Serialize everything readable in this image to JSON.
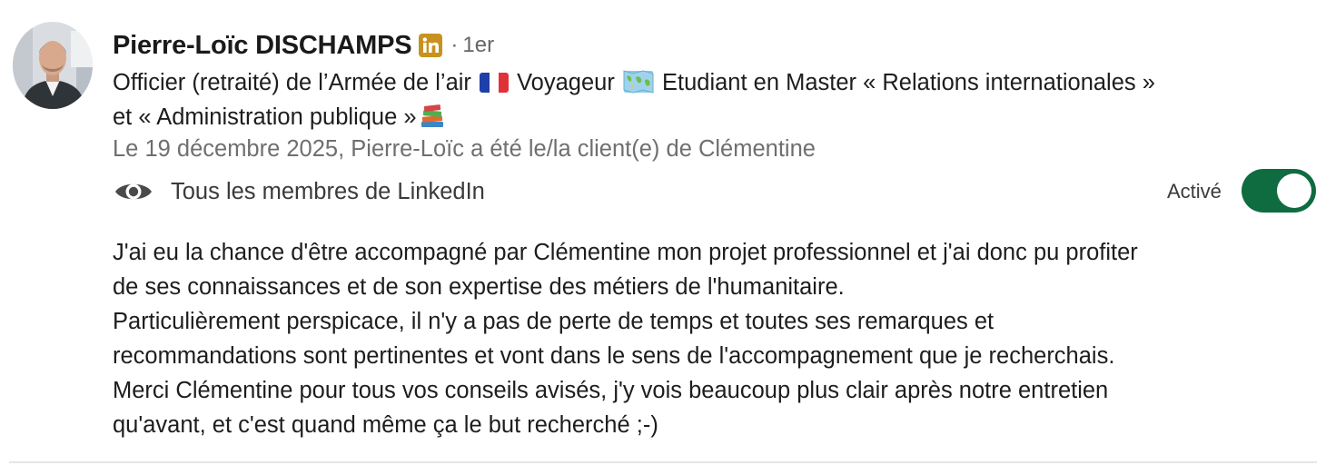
{
  "author": {
    "name": "Pierre-Loïc DISCHAMPS",
    "badge_icon": "linkedin-icon",
    "separator": "·",
    "degree": "1er"
  },
  "headline": {
    "part1": "Officier (retraité) de l’Armée de l’air ",
    "part2": " Voyageur ",
    "part3": " Etudiant en Master « Relations internationales »",
    "part4": "et « Administration publique »"
  },
  "meta": "Le 19 décembre 2025, Pierre-Loïc a été le/la client(e) de Clémentine",
  "visibility": {
    "icon": "eye-icon",
    "label": "Tous les membres de LinkedIn"
  },
  "toggle": {
    "label": "Activé",
    "state": "on",
    "color": "#0f6b40"
  },
  "recommendation": {
    "lines": [
      "J'ai eu la chance d'être accompagné par Clémentine mon projet professionnel et j'ai donc pu profiter",
      "de ses connaissances et de son expertise des métiers de l'humanitaire.",
      "Particulièrement perspicace, il n'y a pas de perte de temps et toutes ses remarques et",
      "recommandations sont pertinentes et vont dans le sens de l'accompagnement que je recherchais.",
      "Merci Clémentine pour tous vos conseils avisés, j'y vois beaucoup plus clair après notre entretien",
      "qu'avant, et c'est quand même ça le but recherché ;-)"
    ]
  },
  "colors": {
    "badge": "#c8921f",
    "muted_text": "#6f6f6f"
  }
}
